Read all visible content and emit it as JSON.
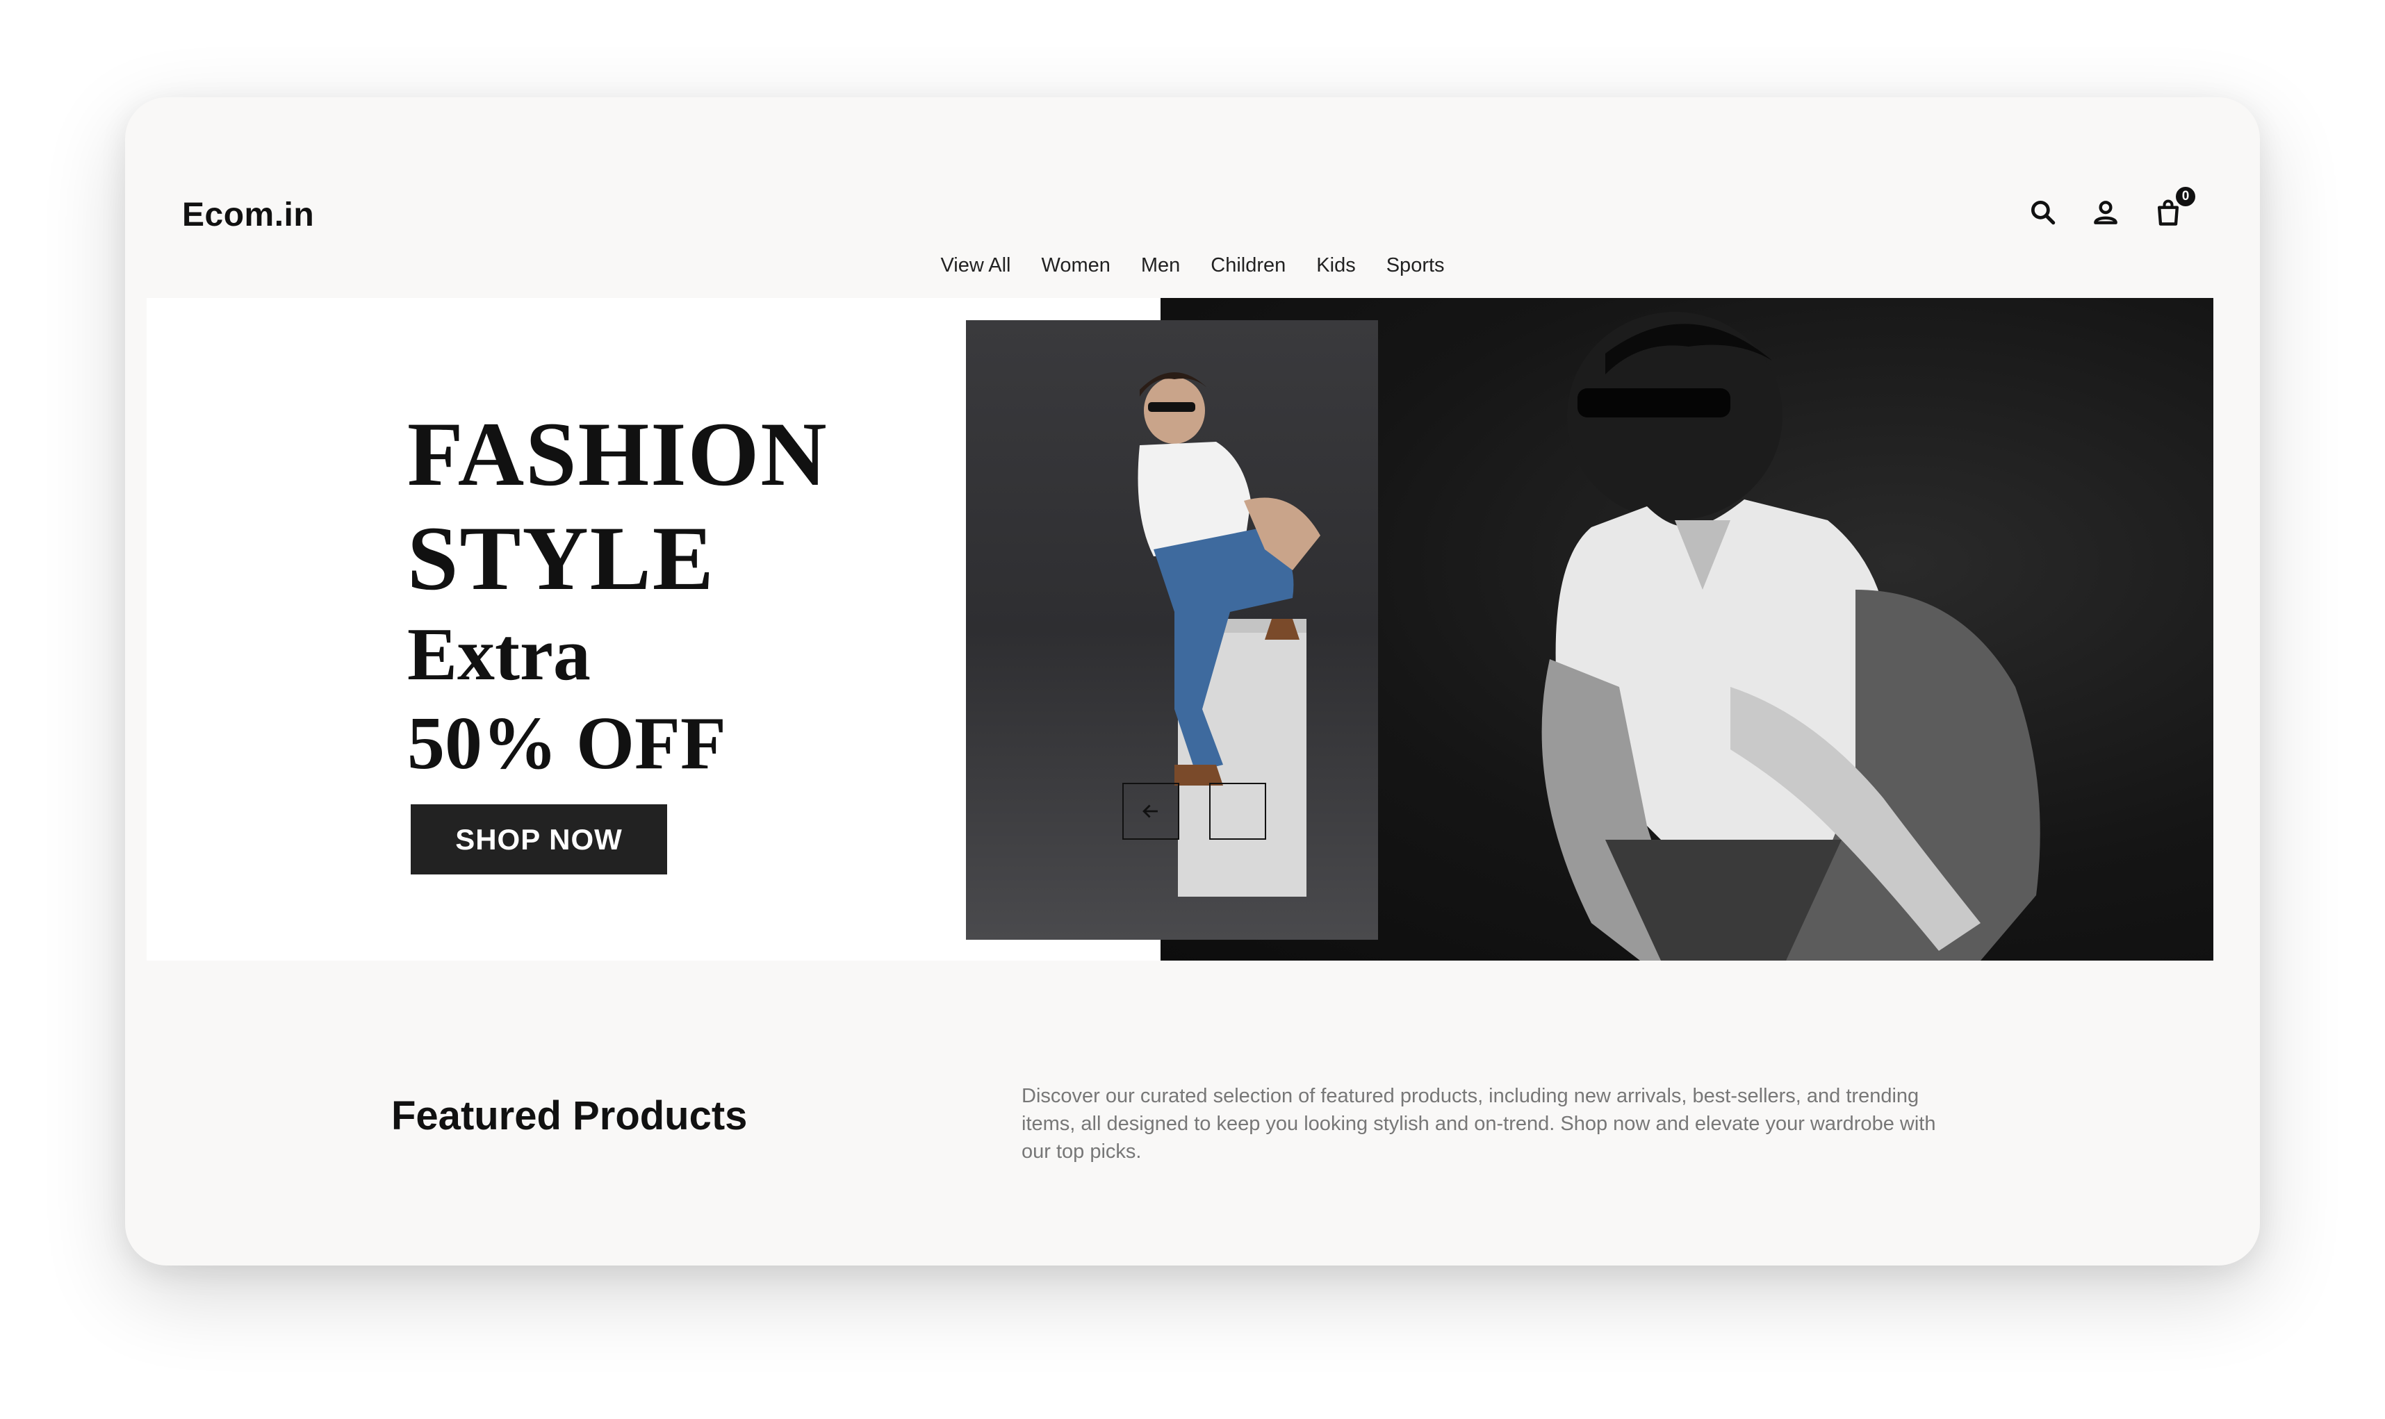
{
  "brand": {
    "logo": "Ecom.in"
  },
  "nav": {
    "items": [
      {
        "label": "View All"
      },
      {
        "label": "Women"
      },
      {
        "label": "Men"
      },
      {
        "label": "Children"
      },
      {
        "label": "Kids"
      },
      {
        "label": "Sports"
      }
    ]
  },
  "header_actions": {
    "search_icon": "search-icon",
    "account_icon": "user-icon",
    "cart_icon": "shopping-bag-icon",
    "cart_count": "0"
  },
  "hero": {
    "line1": "FASHION",
    "line2": "STYLE",
    "line3": "Extra",
    "line4": "50% OFF",
    "cta_label": "SHOP NOW",
    "prev_icon": "arrow-left-icon",
    "next_icon": "arrow-right-icon"
  },
  "featured": {
    "title": "Featured Products",
    "description": "Discover our curated selection of featured products, including new arrivals, best-sellers, and trending items, all designed to keep you looking stylish and on-trend. Shop now and elevate your wardrobe with our top picks."
  },
  "colors": {
    "page_background": "#f9f8f7",
    "accent_dark": "#222222",
    "text_primary": "#111111",
    "text_muted": "#777777"
  }
}
